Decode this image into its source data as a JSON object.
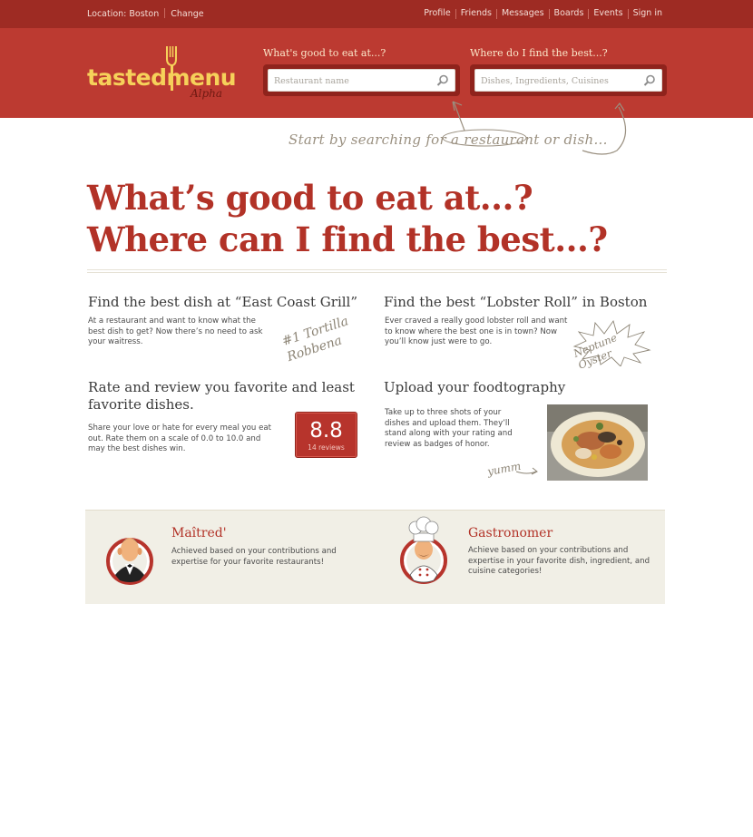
{
  "topbar": {
    "location_label": "Location: Boston",
    "change_label": "Change",
    "nav": [
      "Profile",
      "Friends",
      "Messages",
      "Boards",
      "Events",
      "Sign in"
    ]
  },
  "header": {
    "logo_word": "tastedmenu",
    "logo_sub": "Alpha",
    "search1": {
      "label": "What's good to eat at...?",
      "placeholder": "Restaurant name"
    },
    "search2": {
      "label": "Where do I find the best...?",
      "placeholder": "Dishes, Ingredients, Cuisines"
    }
  },
  "hint": "Start by searching for a restaurant or dish...",
  "headline": {
    "line1": "What’s good to eat at...?",
    "line2": "Where can I find the best...?"
  },
  "features": [
    {
      "title": "Find the best dish at “East Coast Grill”",
      "text": "At a restaurant and want to know what the best dish to get? Now there’s no need to ask your waitress.",
      "script": "#1 Tortilla Robbena"
    },
    {
      "title": "Find the best “Lobster Roll” in Boston",
      "text": "Ever craved a really good lobster roll and want to know where the best one is in town? Now you’ll know just were to go.",
      "script": "Neptune Oyster"
    },
    {
      "title": "Rate and review you favorite and least favorite dishes.",
      "text": "Share your love or hate for every meal you eat out. Rate them on a scale of 0.0 to 10.0 and may the best dishes win.",
      "rating": {
        "score": "8.8",
        "reviews": "14 reviews"
      }
    },
    {
      "title": "Upload your foodtography",
      "text": "Take up to three shots of your dishes and upload them. They’ll stand along with your rating and review as badges of honor.",
      "script": "yumm"
    }
  ],
  "badges": [
    {
      "title": "Maîtred'",
      "text": "Achieved based on your contributions and expertise for your favorite restaurants!",
      "icon": "maitred-icon"
    },
    {
      "title": "Gastronomer",
      "text": "Achieve based on your contributions and expertise in your favorite dish, ingredient, and cuisine categories!",
      "icon": "chef-icon"
    }
  ],
  "colors": {
    "brand_red": "#bc3a31",
    "dark_red": "#9e2b23",
    "logo_yellow": "#f6d15a",
    "badge_bg": "#f1efe6"
  }
}
